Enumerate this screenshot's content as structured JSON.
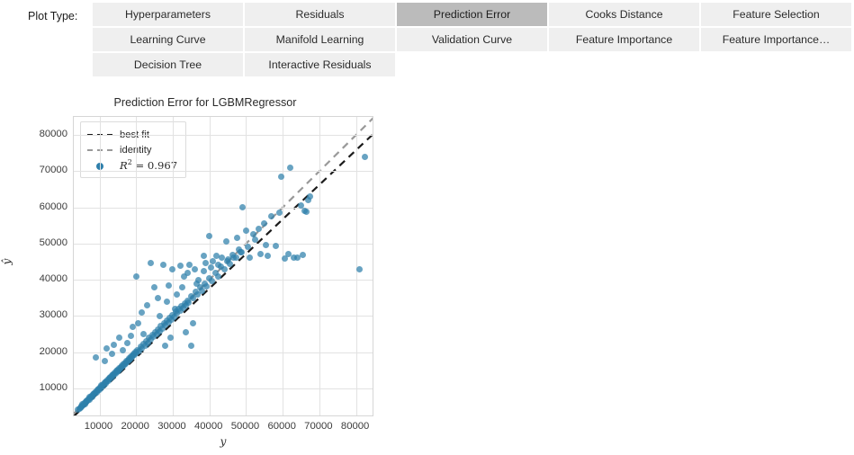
{
  "plot_type": {
    "label": "Plot Type:",
    "selected": "Prediction Error",
    "buttons": [
      [
        "Hyperparameters",
        "Residuals",
        "Prediction Error",
        "Cooks Distance",
        "Feature Selection"
      ],
      [
        "Learning Curve",
        "Manifold Learning",
        "Validation Curve",
        "Feature Importance",
        "Feature Importance…"
      ],
      [
        "Decision Tree",
        "Interactive Residuals",
        "",
        "",
        ""
      ]
    ]
  },
  "chart_data": {
    "type": "scatter",
    "title": "Prediction Error for LGBMRegressor",
    "xlabel": "y",
    "ylabel": "ŷ",
    "xlim": [
      3000,
      85000
    ],
    "ylim": [
      2000,
      85000
    ],
    "xticks": [
      10000,
      20000,
      30000,
      40000,
      50000,
      60000,
      70000,
      80000
    ],
    "yticks": [
      10000,
      20000,
      30000,
      40000,
      50000,
      60000,
      70000,
      80000
    ],
    "grid": true,
    "legend_position": "upper left",
    "marker_color": "#2e7fab",
    "legend": [
      {
        "label": "best fit",
        "style": "dashed-line",
        "color": "#1b1b1b"
      },
      {
        "label": "identity",
        "style": "dashed-line",
        "color": "#999999"
      },
      {
        "label": "R² = 0.967",
        "style": "marker",
        "color": "#2e7fab"
      }
    ],
    "r_squared": 0.967,
    "best_fit": {
      "slope": 0.955,
      "intercept": -600,
      "color": "#1b1b1b",
      "style": "dashed"
    },
    "identity": {
      "slope": 1.0,
      "intercept": 0,
      "color": "#999999",
      "style": "dashed"
    },
    "points": [
      [
        4200,
        4000
      ],
      [
        4500,
        4400
      ],
      [
        4800,
        4600
      ],
      [
        5000,
        5100
      ],
      [
        5200,
        4900
      ],
      [
        5400,
        5500
      ],
      [
        5600,
        5300
      ],
      [
        5800,
        5900
      ],
      [
        6000,
        5700
      ],
      [
        6200,
        6300
      ],
      [
        6400,
        6100
      ],
      [
        6600,
        6700
      ],
      [
        6800,
        6500
      ],
      [
        7000,
        7100
      ],
      [
        7200,
        6900
      ],
      [
        7400,
        7500
      ],
      [
        7600,
        7300
      ],
      [
        7800,
        7900
      ],
      [
        8000,
        7700
      ],
      [
        8200,
        8300
      ],
      [
        8400,
        8100
      ],
      [
        8600,
        8700
      ],
      [
        8800,
        8500
      ],
      [
        9000,
        9100
      ],
      [
        9200,
        8900
      ],
      [
        9400,
        9500
      ],
      [
        9600,
        9300
      ],
      [
        9800,
        9900
      ],
      [
        10000,
        9700
      ],
      [
        10200,
        10300
      ],
      [
        10400,
        10100
      ],
      [
        10600,
        10700
      ],
      [
        10800,
        10500
      ],
      [
        11000,
        11100
      ],
      [
        11200,
        10900
      ],
      [
        11400,
        11500
      ],
      [
        11600,
        11300
      ],
      [
        11800,
        11900
      ],
      [
        12000,
        11700
      ],
      [
        12200,
        12300
      ],
      [
        12400,
        12100
      ],
      [
        12600,
        12700
      ],
      [
        12800,
        12500
      ],
      [
        13000,
        13100
      ],
      [
        13200,
        12900
      ],
      [
        13400,
        13500
      ],
      [
        13600,
        13300
      ],
      [
        13800,
        13900
      ],
      [
        14000,
        13700
      ],
      [
        14200,
        14300
      ],
      [
        14400,
        14100
      ],
      [
        14600,
        14700
      ],
      [
        14800,
        14500
      ],
      [
        15000,
        15100
      ],
      [
        15200,
        14900
      ],
      [
        15400,
        15500
      ],
      [
        15600,
        15300
      ],
      [
        15800,
        15900
      ],
      [
        16000,
        15700
      ],
      [
        16200,
        16300
      ],
      [
        16400,
        16100
      ],
      [
        16600,
        16700
      ],
      [
        16800,
        16500
      ],
      [
        17000,
        17100
      ],
      [
        17200,
        16900
      ],
      [
        17400,
        17500
      ],
      [
        17600,
        17300
      ],
      [
        17800,
        17900
      ],
      [
        18000,
        17700
      ],
      [
        18200,
        18300
      ],
      [
        18400,
        18100
      ],
      [
        18600,
        18700
      ],
      [
        18800,
        18500
      ],
      [
        19000,
        19100
      ],
      [
        19200,
        18900
      ],
      [
        19400,
        19500
      ],
      [
        19600,
        19300
      ],
      [
        19800,
        19900
      ],
      [
        20000,
        19700
      ],
      [
        20400,
        20500
      ],
      [
        20800,
        20300
      ],
      [
        21200,
        21400
      ],
      [
        21600,
        21000
      ],
      [
        22000,
        22300
      ],
      [
        22400,
        21800
      ],
      [
        22800,
        23100
      ],
      [
        23200,
        22600
      ],
      [
        23600,
        23900
      ],
      [
        24000,
        23400
      ],
      [
        24400,
        24700
      ],
      [
        24800,
        24200
      ],
      [
        25200,
        25500
      ],
      [
        25600,
        25000
      ],
      [
        26000,
        26300
      ],
      [
        26400,
        25800
      ],
      [
        26800,
        27100
      ],
      [
        27200,
        26600
      ],
      [
        27600,
        27900
      ],
      [
        28000,
        27400
      ],
      [
        28400,
        28700
      ],
      [
        28800,
        28200
      ],
      [
        29200,
        29500
      ],
      [
        29600,
        29000
      ],
      [
        30000,
        30300
      ],
      [
        30400,
        29800
      ],
      [
        30800,
        31100
      ],
      [
        31200,
        30600
      ],
      [
        31600,
        31900
      ],
      [
        32000,
        31400
      ],
      [
        32400,
        32700
      ],
      [
        32800,
        32200
      ],
      [
        33200,
        33500
      ],
      [
        33600,
        33000
      ],
      [
        34000,
        34300
      ],
      [
        34400,
        33800
      ],
      [
        35000,
        35400
      ],
      [
        35600,
        34900
      ],
      [
        36200,
        36600
      ],
      [
        36800,
        35800
      ],
      [
        37400,
        37800
      ],
      [
        38000,
        37000
      ],
      [
        38600,
        39000
      ],
      [
        39200,
        38200
      ],
      [
        40000,
        40400
      ],
      [
        40800,
        39600
      ],
      [
        41600,
        42000
      ],
      [
        42400,
        41000
      ],
      [
        43200,
        43600
      ],
      [
        44000,
        42800
      ],
      [
        44800,
        45200
      ],
      [
        45600,
        44400
      ],
      [
        46400,
        46800
      ],
      [
        47200,
        46000
      ],
      [
        48000,
        48400
      ],
      [
        48800,
        47600
      ],
      [
        9000,
        18500
      ],
      [
        20000,
        41000
      ],
      [
        25000,
        38000
      ],
      [
        22000,
        25000
      ],
      [
        28000,
        21700
      ],
      [
        35000,
        21800
      ],
      [
        30000,
        43000
      ],
      [
        27500,
        44200
      ],
      [
        32000,
        43800
      ],
      [
        33000,
        40800
      ],
      [
        38500,
        46500
      ],
      [
        40000,
        52000
      ],
      [
        42000,
        46500
      ],
      [
        43500,
        46000
      ],
      [
        46500,
        46200
      ],
      [
        49000,
        60000
      ],
      [
        50500,
        49000
      ],
      [
        52000,
        52500
      ],
      [
        53500,
        54000
      ],
      [
        55000,
        55500
      ],
      [
        55500,
        49500
      ],
      [
        57000,
        57500
      ],
      [
        58000,
        49300
      ],
      [
        59000,
        58500
      ],
      [
        59500,
        68500
      ],
      [
        60500,
        45800
      ],
      [
        61500,
        47000
      ],
      [
        62000,
        71000
      ],
      [
        63000,
        46200
      ],
      [
        64000,
        46000
      ],
      [
        65000,
        60500
      ],
      [
        65500,
        46800
      ],
      [
        66000,
        59000
      ],
      [
        66500,
        58800
      ],
      [
        67000,
        62000
      ],
      [
        67500,
        63000
      ],
      [
        81000,
        43000
      ],
      [
        82500,
        74000
      ],
      [
        24000,
        44500
      ],
      [
        26000,
        35000
      ],
      [
        15500,
        24000
      ],
      [
        14000,
        22000
      ],
      [
        12000,
        21000
      ],
      [
        20500,
        28000
      ],
      [
        21500,
        31000
      ],
      [
        19000,
        27000
      ],
      [
        23000,
        33000
      ],
      [
        31000,
        36000
      ],
      [
        29000,
        38500
      ],
      [
        34500,
        44000
      ],
      [
        36000,
        43000
      ],
      [
        37000,
        40000
      ],
      [
        39000,
        44500
      ],
      [
        41000,
        45000
      ],
      [
        44500,
        50500
      ],
      [
        47500,
        51500
      ],
      [
        50000,
        53500
      ],
      [
        51000,
        46200
      ],
      [
        54000,
        47000
      ],
      [
        56000,
        46500
      ],
      [
        35500,
        28000
      ],
      [
        33500,
        25500
      ],
      [
        29500,
        24000
      ],
      [
        17500,
        22500
      ],
      [
        16500,
        20500
      ],
      [
        18500,
        24500
      ],
      [
        13500,
        19500
      ],
      [
        11500,
        17500
      ],
      [
        26500,
        30000
      ],
      [
        28500,
        34000
      ],
      [
        30500,
        32000
      ],
      [
        32500,
        38000
      ],
      [
        34000,
        42000
      ],
      [
        36500,
        39000
      ],
      [
        38500,
        42500
      ],
      [
        40500,
        43500
      ],
      [
        42500,
        44000
      ],
      [
        45000,
        45500
      ],
      [
        48500,
        47500
      ],
      [
        52500,
        51000
      ]
    ]
  }
}
